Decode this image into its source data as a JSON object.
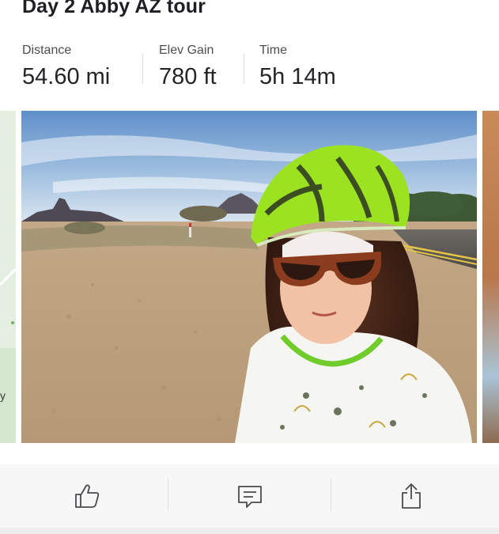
{
  "activity": {
    "title": "Day 2 Abby AZ tour"
  },
  "stats": [
    {
      "label": "Distance",
      "value": "54.60 mi"
    },
    {
      "label": "Elev Gain",
      "value": "780 ft"
    },
    {
      "label": "Time",
      "value": "5h 14m"
    }
  ],
  "map_peek": {
    "visible_text": "y"
  },
  "actions": {
    "kudos_icon": "thumbs-up-icon",
    "comment_icon": "comment-icon",
    "share_icon": "share-icon"
  },
  "colors": {
    "helmet": "#9be320",
    "divider": "#dcdcdf",
    "action_bar_bg": "#f7f7f8"
  }
}
